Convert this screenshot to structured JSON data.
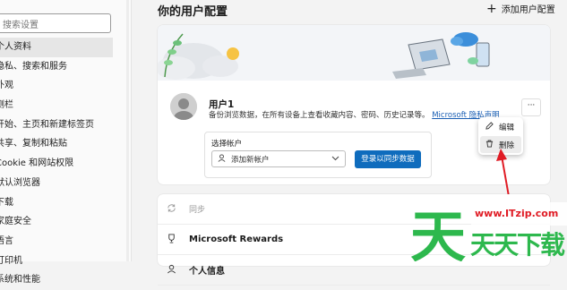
{
  "sidebar": {
    "search_placeholder": "搜索设置",
    "items": [
      {
        "label": "个人资料",
        "active": true
      },
      {
        "label": "隐私、搜索和服务"
      },
      {
        "label": "外观"
      },
      {
        "label": "侧栏"
      },
      {
        "label": "开始、主页和新建标签页"
      },
      {
        "label": "共享、复制和粘贴"
      },
      {
        "label": "Cookie 和网站权限"
      },
      {
        "label": "默认浏览器"
      },
      {
        "label": "下载"
      },
      {
        "label": "家庭安全"
      },
      {
        "label": "语言"
      },
      {
        "label": "打印机"
      },
      {
        "label": "系统和性能"
      }
    ]
  },
  "header": {
    "title": "你的用户配置",
    "add_profile_label": "添加用户配置"
  },
  "profile": {
    "name": "用户1",
    "description": "备份浏览数据，在所有设备上查看收藏内容、密码、历史记录等。",
    "privacy_link": "Microsoft 隐私声明",
    "more_label": "···",
    "choose_account_label": "选择帐户",
    "account_select_value": "添加新帐户",
    "sync_button_label": "登录以同步数据"
  },
  "context_menu": {
    "items": [
      {
        "label": "编辑",
        "icon": "pencil-icon"
      },
      {
        "label": "删除",
        "icon": "trash-icon"
      }
    ]
  },
  "settings_list": [
    {
      "label": "同步",
      "icon": "sync-icon",
      "disabled": true
    },
    {
      "label": "Microsoft Rewards",
      "icon": "trophy-icon"
    },
    {
      "label": "个人信息",
      "icon": "person-icon"
    }
  ],
  "watermark": {
    "url": "www.ITzip.com",
    "text": "天天下载"
  },
  "colors": {
    "accent": "#0f6cbd",
    "watermark_green": "#2db84d",
    "annotation_red": "#e01b24"
  }
}
